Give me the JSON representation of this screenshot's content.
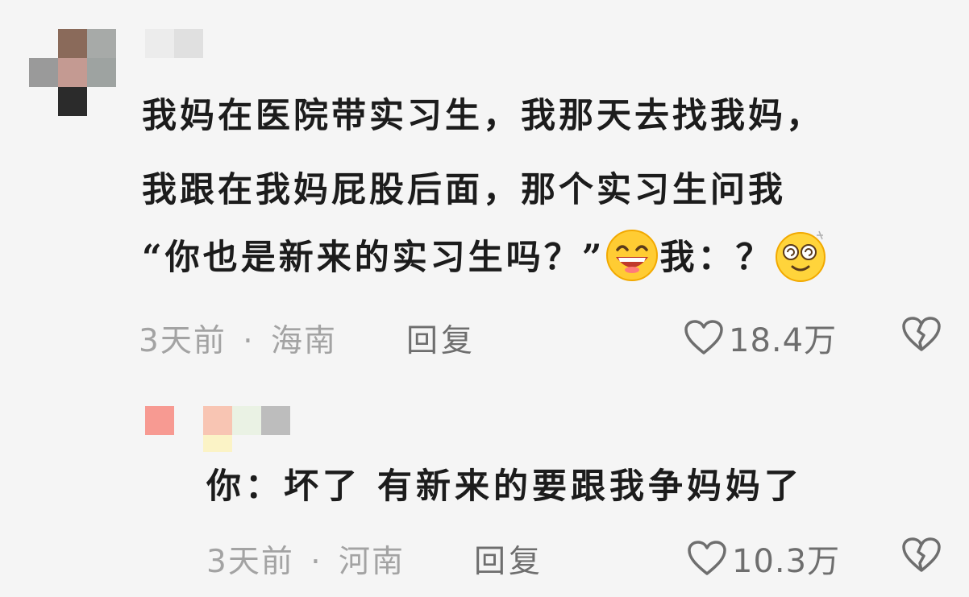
{
  "comment": {
    "lines": [
      "我妈在医院带实习生，我那天去找我妈，",
      "我跟在我妈屁股后面，那个实习生问我"
    ],
    "line3_quote": "“你也是新来的实习生吗？”",
    "line3_after": "我：？",
    "emoji_1": "grinning-emoji",
    "emoji_2": "dizzy-smile-emoji",
    "time": "3天前",
    "dot": "·",
    "location": "海南",
    "reply_label": "回复",
    "likes": "18.4万"
  },
  "reply": {
    "text": "你：坏了 有新来的要跟我争妈妈了",
    "time": "3天前",
    "dot": "·",
    "location": "河南",
    "reply_label": "回复",
    "likes": "10.3万"
  },
  "icons": {
    "like": "heart-icon",
    "dislike": "broken-heart-icon"
  },
  "colors": {
    "background": "#f5f5f5",
    "text": "#1c1c1c",
    "meta": "#a3a3a3",
    "action": "#6e6e6e"
  }
}
